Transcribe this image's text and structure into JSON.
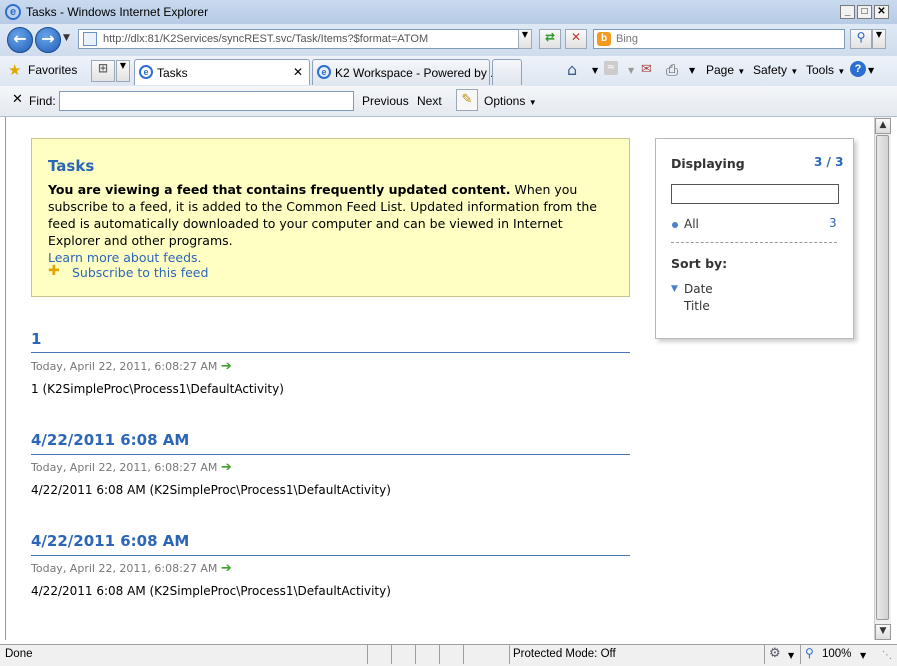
{
  "window": {
    "title": "Tasks - Windows Internet Explorer",
    "controls": {
      "minimize": "_",
      "maximize": "□",
      "close": "✕"
    }
  },
  "address_bar": {
    "url": "http://dlx:81/K2Services/syncREST.svc/Task/Items?$format=ATOM",
    "search_placeholder": "Bing"
  },
  "favorites_bar": {
    "favorites_label": "Favorites",
    "tabs": [
      {
        "label": "Tasks",
        "active": true
      },
      {
        "label": "K2 Workspace - Powered by ...",
        "active": false
      }
    ],
    "commands": {
      "page": "Page",
      "safety": "Safety",
      "tools": "Tools"
    }
  },
  "find_bar": {
    "label": "Find:",
    "value": "",
    "previous": "Previous",
    "next": "Next",
    "options": "Options"
  },
  "banner": {
    "title": "Tasks",
    "bold_text": "You are viewing a feed that contains frequently updated content.",
    "body_text": " When you subscribe to a feed, it is added to the Common Feed List. Updated information from the feed is automatically downloaded to your computer and can be viewed in Internet Explorer and other programs.",
    "learn_more": "Learn more about feeds.",
    "subscribe": "Subscribe to this feed"
  },
  "feed_items": [
    {
      "title": "1",
      "date": "Today, April 22, 2011, 6:08:27 AM",
      "body": "1 (K2SimpleProc\\Process1\\DefaultActivity)"
    },
    {
      "title": "4/22/2011 6:08 AM",
      "date": "Today, April 22, 2011, 6:08:27 AM",
      "body": "4/22/2011 6:08 AM (K2SimpleProc\\Process1\\DefaultActivity)"
    },
    {
      "title": "4/22/2011 6:08 AM",
      "date": "Today, April 22, 2011, 6:08:27 AM",
      "body": "4/22/2011 6:08 AM (K2SimpleProc\\Process1\\DefaultActivity)"
    }
  ],
  "side_panel": {
    "displaying_label": "Displaying",
    "displaying_count": "3 / 3",
    "filter_value": "",
    "all_label": "All",
    "all_count": "3",
    "sort_label": "Sort by:",
    "sort_options": [
      "Date",
      "Title"
    ]
  },
  "status_bar": {
    "status": "Done",
    "protected_mode": "Protected Mode: Off",
    "zoom": "100%"
  },
  "colors": {
    "link_blue": "#2c66b8",
    "banner_yellow": "#ffffc4",
    "arrow_green": "#3fa02b"
  }
}
